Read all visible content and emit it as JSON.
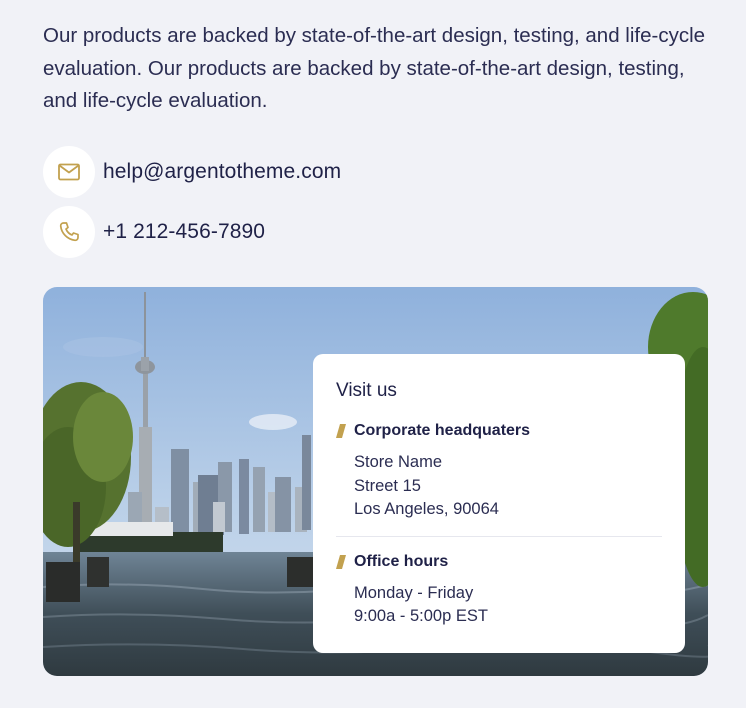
{
  "intro": {
    "text": "Our products are backed by state-of-the-art design, testing, and life-cycle evaluation. Our products are backed by state-of-the-art design, testing, and life-cycle evaluation."
  },
  "contacts": {
    "email": "help@argentotheme.com",
    "phone": "+1 212-456-7890"
  },
  "card": {
    "title": "Visit us",
    "headquarters": {
      "heading": "Corporate headquaters",
      "line1": "Store Name",
      "line2": "Street 15",
      "line3": "Los Angeles, 90064"
    },
    "hours": {
      "heading": "Office hours",
      "line1": "Monday - Friday",
      "line2": "9:00a - 5:00p EST"
    }
  },
  "icons": {
    "email": "mail-icon",
    "phone": "phone-icon",
    "section": "slash-accent-icon"
  },
  "colors": {
    "background": "#f1f2f7",
    "text": "#1f2147",
    "accent": "#c2a14f",
    "card": "#ffffff"
  }
}
